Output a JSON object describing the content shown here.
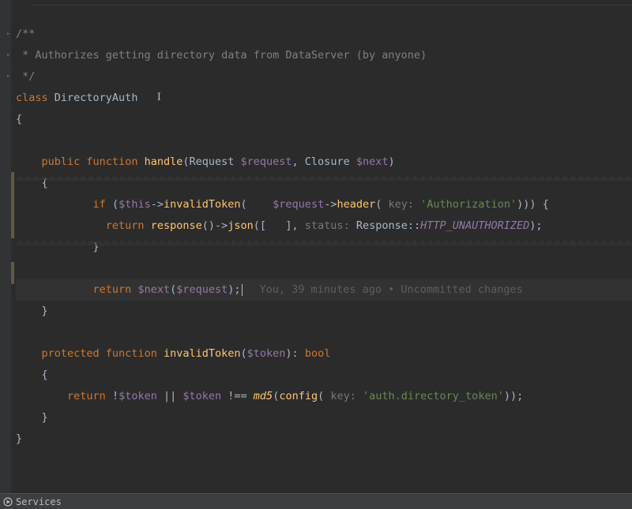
{
  "code": {
    "l1": "/**",
    "l2": " * Authorizes getting directory data from DataServer (by anyone)",
    "l3": " */",
    "l4k": "class ",
    "l4n": "DirectoryAuth",
    "l5": "{",
    "l7a": "public ",
    "l7b": "function ",
    "l7c": "handle",
    "l7d": "(Request ",
    "l7e": "$request",
    "l7f": ", Closure ",
    "l7g": "$next",
    "l7h": ")",
    "l8": "{",
    "l9a": "if ",
    "l9b": "(",
    "l9c": "$this",
    "l9d": "->",
    "l9e": "invalidToken",
    "l9f": "(    ",
    "l9g": "$request",
    "l9h": "->",
    "l9i": "header",
    "l9j": "( ",
    "l9jk": "key: ",
    "l9k": "'Authorization'",
    "l9l": "))) {",
    "l10a": "return ",
    "l10b": "response",
    "l10c": "()->",
    "l10d": "json",
    "l10e": "([   ], ",
    "l10ek": "status: ",
    "l10f": "Response",
    "l10g": "::",
    "l10h": "HTTP_UNAUTHORIZED",
    "l10i": ");",
    "l11": "}",
    "l13a": "return ",
    "l13b": "$next",
    "l13c": "(",
    "l13d": "$request",
    "l13e": ");",
    "l14": "}",
    "l16a": "protected ",
    "l16b": "function ",
    "l16c": "invalidToken",
    "l16d": "(",
    "l16e": "$token",
    "l16f": "): ",
    "l16g": "bool",
    "l17": "{",
    "l18a": "return ",
    "l18b": "!",
    "l18c": "$token",
    "l18d": " || ",
    "l18e": "$token",
    "l18f": " !== ",
    "l18g": "md5",
    "l18h": "(",
    "l18i": "config",
    "l18j": "( ",
    "l18jk": "key: ",
    "l18k": "'auth.directory_token'",
    "l18l": "));",
    "l19": "}",
    "l20": "}"
  },
  "blame": "You, 39 minutes ago • Uncommitted changes",
  "bottom": {
    "services": "Services"
  }
}
